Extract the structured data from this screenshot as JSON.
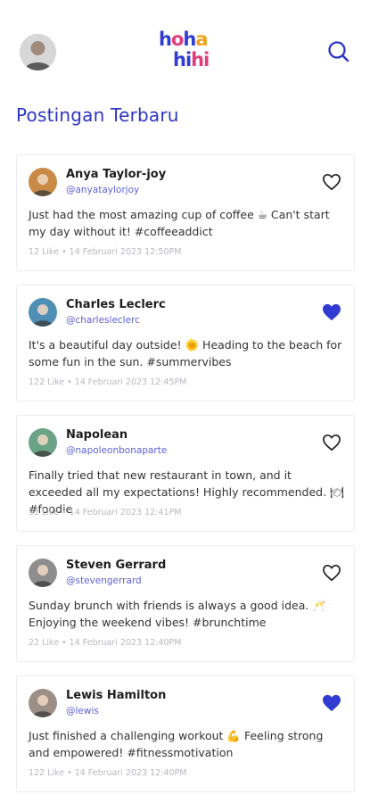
{
  "header": {
    "logo_line1_a": "h",
    "logo_line1_b": "o",
    "logo_line1_c": "h",
    "logo_line1_d": "a",
    "logo_line2_a": "hi",
    "logo_line2_b": "hi",
    "avatar_icon": "profile-avatar",
    "search_icon": "search-icon"
  },
  "section": {
    "title": "Postingan Terbaru"
  },
  "colors": {
    "brand_blue": "#2e35c4",
    "heart_filled": "#2f3bd1",
    "handle": "#5b61d6",
    "meta": "#b9b9bf"
  },
  "posts": [
    {
      "name": "Anya Taylor-joy",
      "handle": "@anyataylorjoy",
      "text": "Just had the most amazing cup of coffee ☕ Can't start my day without it! #coffeeaddict",
      "likes": "12 Like",
      "time": "14 Februari 2023 12:50PM",
      "liked": false,
      "avatar_color": "#c98a45"
    },
    {
      "name": "Charles Leclerc",
      "handle": "@charlesleclerc",
      "text": "It's a beautiful day outside! 🌞 Heading to the beach for some fun in the sun. #summervibes",
      "likes": "122 Like",
      "time": "14 Februari 2023 12:45PM",
      "liked": true,
      "avatar_color": "#4f8fb5"
    },
    {
      "name": "Napolean",
      "handle": "@napoleonbonaparte",
      "text": "Finally tried that new restaurant in town, and it exceeded all my expectations! Highly recommended. 🍽 #foodie",
      "likes": "32 Like",
      "time": "14 Februari 2023 12:41PM",
      "liked": false,
      "avatar_color": "#6aa386"
    },
    {
      "name": "Steven Gerrard",
      "handle": "@stevengerrard",
      "text": "Sunday brunch with friends is always a good idea. 🥂 Enjoying the weekend vibes! #brunchtime",
      "likes": "22 Like",
      "time": "14 Februari 2023 12:40PM",
      "liked": false,
      "avatar_color": "#8e8e8e"
    },
    {
      "name": "Lewis Hamilton",
      "handle": "@lewis",
      "text": "Just finished a challenging workout 💪 Feeling strong and empowered! #fitnessmotivation",
      "likes": "122 Like",
      "time": "14 Februari 2023 12:40PM",
      "liked": true,
      "avatar_color": "#9c8f85"
    }
  ]
}
